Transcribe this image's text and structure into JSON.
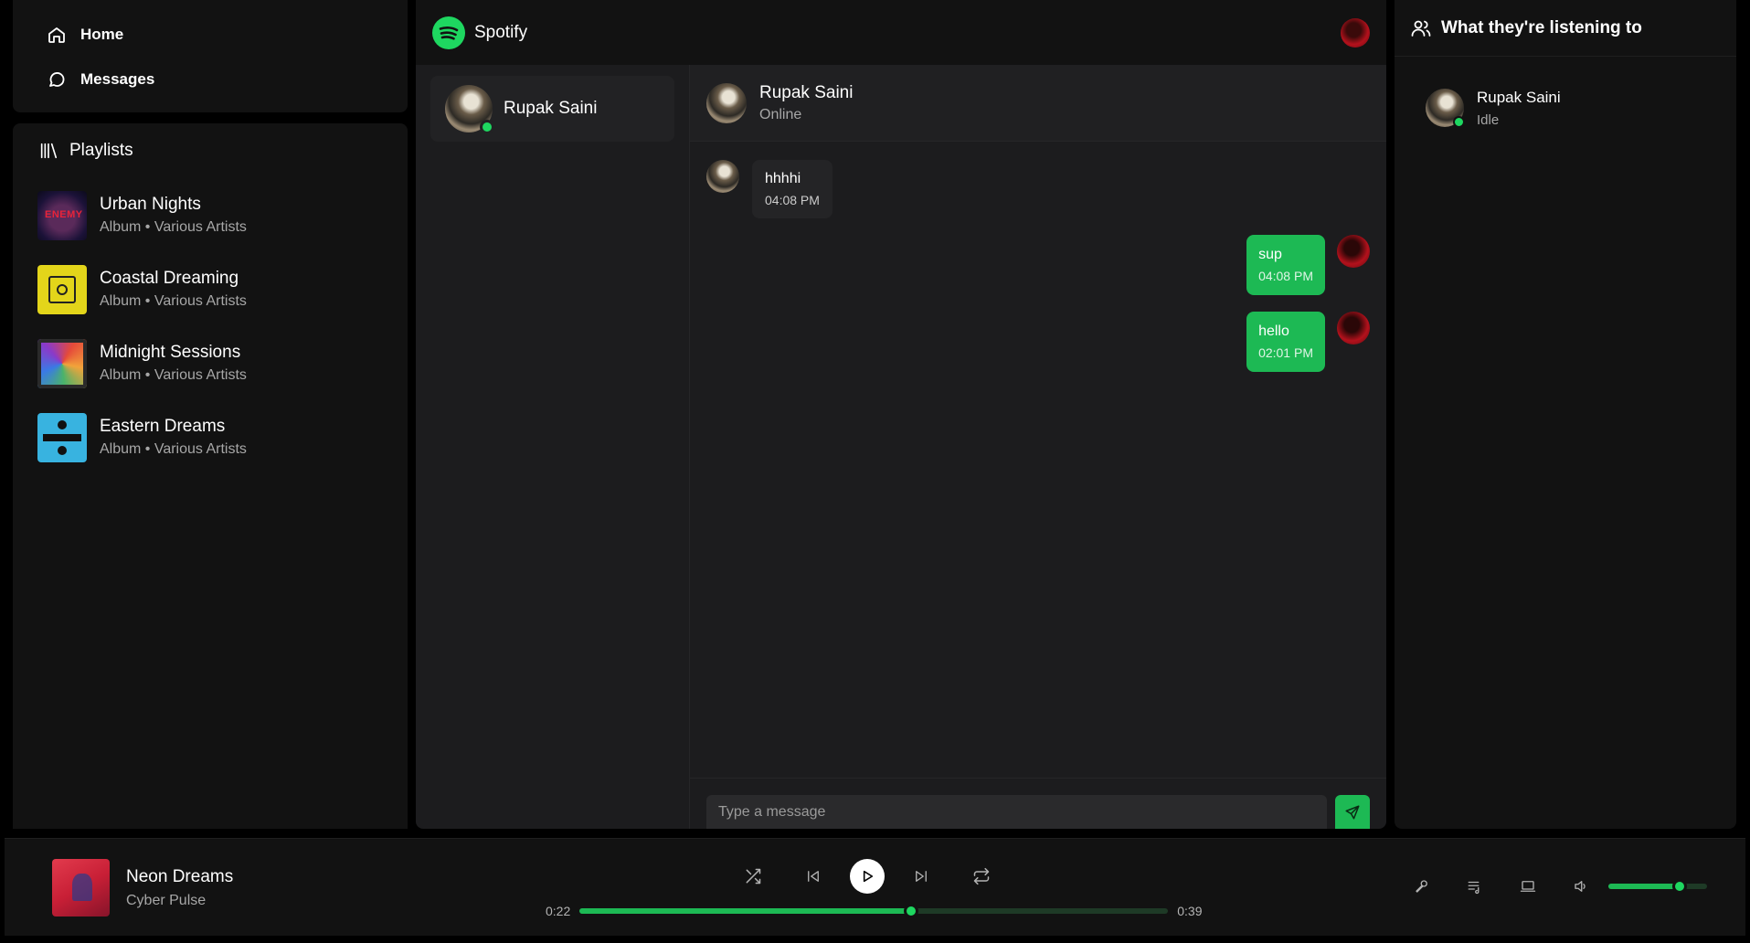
{
  "nav": {
    "items": [
      {
        "label": "Home",
        "icon": "home-icon"
      },
      {
        "label": "Messages",
        "icon": "message-icon"
      }
    ]
  },
  "library": {
    "title": "Playlists",
    "playlists": [
      {
        "name": "Urban Nights",
        "meta": "Album • Various Artists"
      },
      {
        "name": "Coastal Dreaming",
        "meta": "Album • Various Artists"
      },
      {
        "name": "Midnight Sessions",
        "meta": "Album • Various Artists"
      },
      {
        "name": "Eastern Dreams",
        "meta": "Album • Various Artists"
      }
    ]
  },
  "app": {
    "title": "Spotify",
    "accent": "#1db954"
  },
  "conversations": [
    {
      "name": "Rupak Saini",
      "online": true
    }
  ],
  "chat": {
    "header_name": "Rupak Saini",
    "header_status": "Online",
    "messages": [
      {
        "direction": "in",
        "text": "hhhhi",
        "time": "04:08 PM"
      },
      {
        "direction": "out",
        "text": "sup",
        "time": "04:08 PM"
      },
      {
        "direction": "out",
        "text": "hello",
        "time": "02:01 PM"
      }
    ],
    "input_placeholder": "Type a message"
  },
  "friends": {
    "title": "What they're listening to",
    "list": [
      {
        "name": "Rupak Saini",
        "status": "Idle"
      }
    ]
  },
  "player": {
    "track_title": "Neon Dreams",
    "artist": "Cyber Pulse",
    "elapsed": "0:22",
    "duration": "0:39",
    "progress": 0.564,
    "volume": 0.72
  }
}
